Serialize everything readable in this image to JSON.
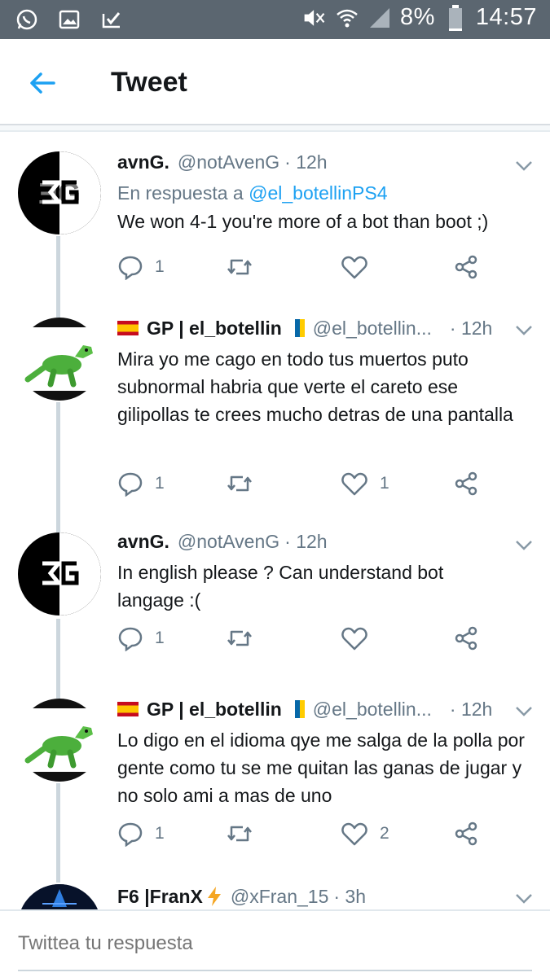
{
  "status_bar": {
    "battery": "8%",
    "time": "14:57",
    "left_icons": [
      "whatsapp-icon",
      "gallery-icon",
      "email-check-icon"
    ],
    "right_icons": [
      "mute-icon",
      "wifi-icon",
      "signal-icon",
      "battery-icon"
    ]
  },
  "header": {
    "title": "Tweet",
    "back_icon": "back-arrow-icon"
  },
  "colors": {
    "accent": "#1da1f2",
    "secondary_text": "#657786",
    "thread_line": "#ccd6dd",
    "status_bar": "#5b6670"
  },
  "tweets": [
    {
      "name": "avnG.",
      "handle": "@notAvenG",
      "time": "· 12h",
      "reply_prefix": "En respuesta a ",
      "reply_mention": "@el_botellinPS4",
      "text": "We won 4-1 you're more of a bot than boot ;)",
      "replies": "1",
      "retweets": "",
      "likes": ""
    },
    {
      "name": "GP | el_botellin",
      "handle": "@el_botellin...",
      "time": "· 12h",
      "text": "Mira yo me cago en todo tus muertos puto subnormal habria que verte el careto ese gilipollas te crees mucho detras de una pantalla",
      "replies": "1",
      "retweets": "",
      "likes": "1"
    },
    {
      "name": "avnG.",
      "handle": "@notAvenG",
      "time": "· 12h",
      "text": "In english please ? Can understand bot langage :(",
      "replies": "1",
      "retweets": "",
      "likes": ""
    },
    {
      "name": "GP | el_botellin",
      "handle": "@el_botellin...",
      "time": "· 12h",
      "text": "Lo digo en el idioma qye me salga de la polla por gente como tu se me quitan las ganas de jugar y no solo ami a mas de uno",
      "replies": "1",
      "retweets": "",
      "likes": "2"
    },
    {
      "name": "F6 |FranX",
      "handle": "@xFran_15",
      "time": "· 3h"
    }
  ],
  "reply_bar": {
    "placeholder": "Twittea tu respuesta"
  }
}
